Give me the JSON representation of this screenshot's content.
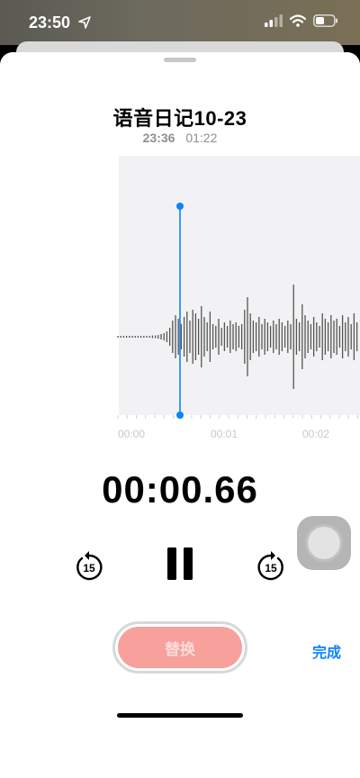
{
  "status_bar": {
    "time": "23:50"
  },
  "recording": {
    "title": "语音日记10-23",
    "recorded_time": "23:36",
    "duration": "01:22",
    "elapsed": "00:00.66"
  },
  "timeline": {
    "ticks": [
      "00:00",
      "00:01",
      "00:02"
    ]
  },
  "buttons": {
    "replace_label": "替换",
    "done_label": "完成"
  },
  "icons": {
    "filter": "sliders-icon",
    "crop": "crop-icon",
    "skip_back": "skip-back-15-icon",
    "pause": "pause-icon",
    "skip_forward": "skip-forward-15-icon"
  },
  "colors": {
    "accent": "#0a84ff",
    "replace_button": "#f7a09c",
    "waveform": "#555555"
  }
}
